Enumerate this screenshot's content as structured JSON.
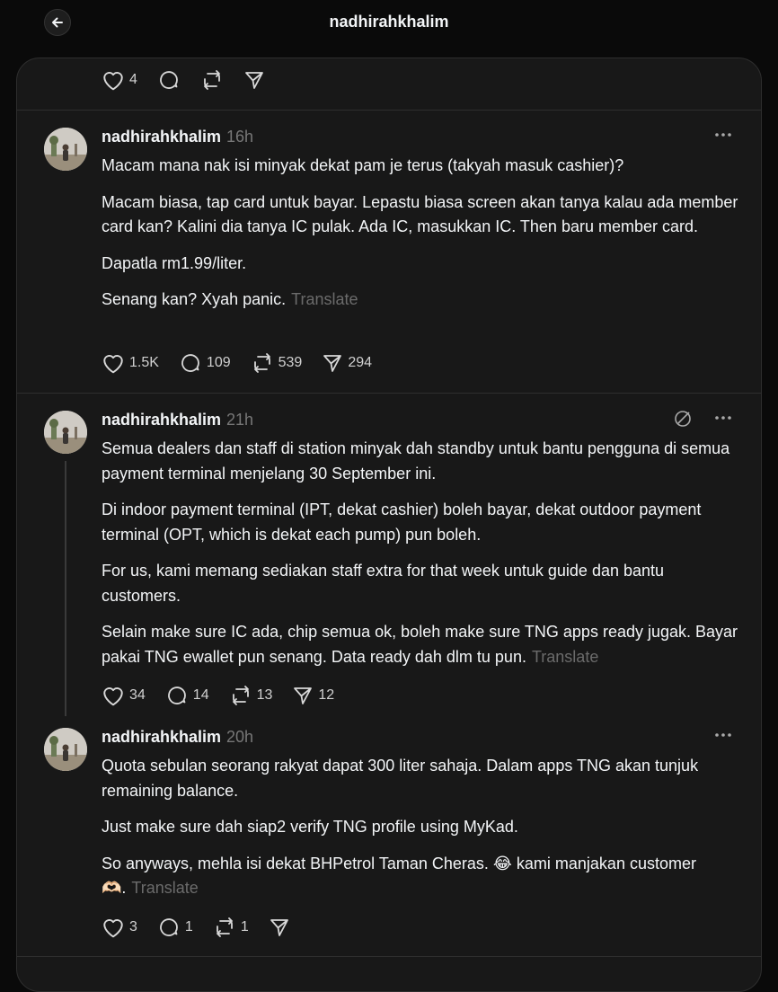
{
  "header": {
    "title": "nadhirahkhalim"
  },
  "top_actions": {
    "likes": "4"
  },
  "posts": [
    {
      "username": "nadhirahkhalim",
      "time": "16h",
      "paragraphs": [
        "Macam mana nak isi minyak dekat pam je terus (takyah masuk cashier)?",
        "Macam biasa, tap card untuk bayar. Lepastu biasa screen akan tanya kalau ada member card kan? Kalini dia tanya IC pulak. Ada IC, masukkan IC. Then baru member card.",
        "Dapatla rm1.99/liter.",
        "Senang kan? Xyah panic."
      ],
      "translate": "Translate",
      "likes": "1.5K",
      "replies": "109",
      "reposts": "539",
      "shares": "294"
    },
    {
      "username": "nadhirahkhalim",
      "time": "21h",
      "paragraphs": [
        "Semua dealers dan staff di station minyak dah standby untuk bantu pengguna di semua payment terminal menjelang 30 September ini.",
        "Di indoor payment terminal (IPT, dekat cashier) boleh bayar, dekat outdoor payment terminal (OPT, which is dekat each pump) pun boleh.",
        "For us, kami memang sediakan staff extra for that week untuk guide dan bantu customers.",
        "Selain make sure IC ada, chip semua ok, boleh make sure TNG apps ready jugak. Bayar pakai TNG ewallet pun senang. Data ready dah dlm tu pun."
      ],
      "translate": "Translate",
      "likes": "34",
      "replies": "14",
      "reposts": "13",
      "shares": "12"
    },
    {
      "username": "nadhirahkhalim",
      "time": "20h",
      "paragraphs": [
        "Quota sebulan seorang rakyat dapat 300 liter sahaja. Dalam apps TNG akan tunjuk remaining balance.",
        "Just make sure dah siap2 verify TNG profile using MyKad.",
        "So anyways, mehla isi dekat BHPetrol Taman Cheras. 😂 kami manjakan customer 🫶🏻."
      ],
      "translate": "Translate",
      "likes": "3",
      "replies": "1",
      "reposts": "1"
    }
  ]
}
